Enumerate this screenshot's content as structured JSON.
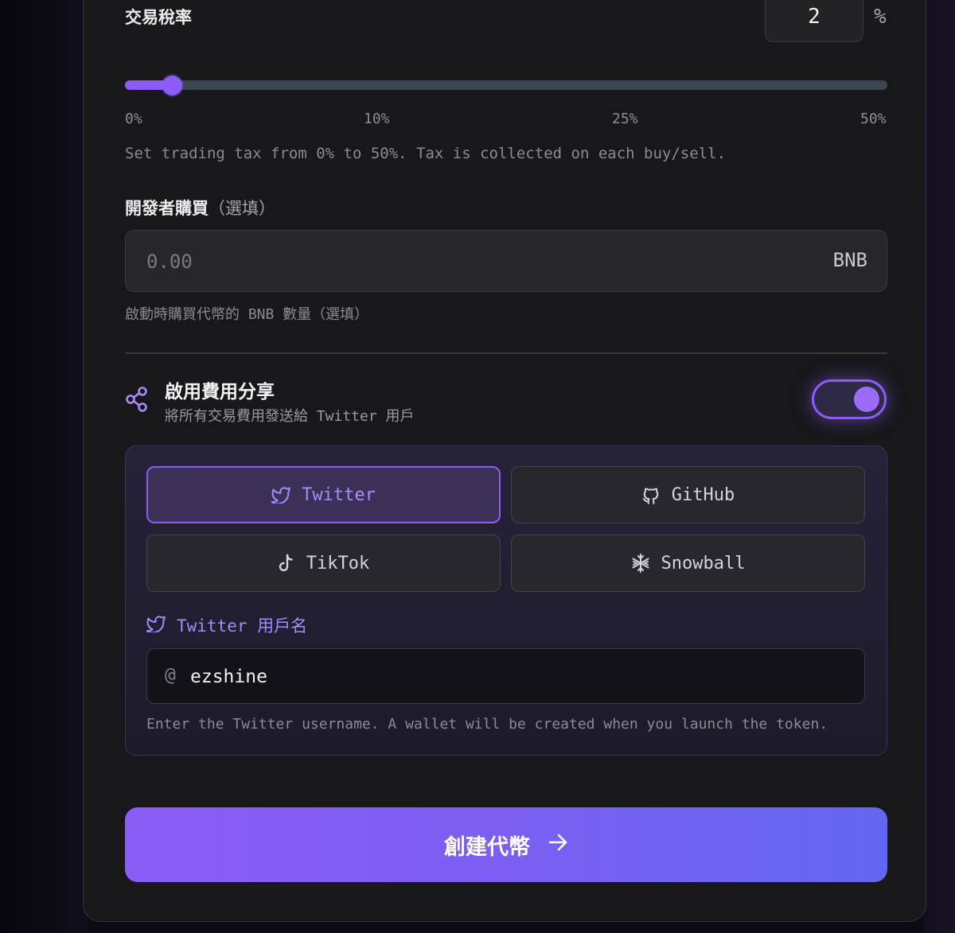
{
  "tax": {
    "label": "交易稅率",
    "value": "2",
    "unit": "%",
    "slider_value_percent": 2,
    "slider_max_percent": 50,
    "ticks": [
      "0%",
      "10%",
      "25%",
      "50%"
    ],
    "help": "Set trading tax from 0% to 50%. Tax is collected on each buy/sell."
  },
  "dev_buy": {
    "label": "開發者購買",
    "optional": "（選填）",
    "placeholder": "0.00",
    "unit": "BNB",
    "help": "啟動時購買代幣的 BNB 數量（選填）"
  },
  "fee_share": {
    "title": "啟用費用分享",
    "subtitle": "將所有交易費用發送給 Twitter 用戶",
    "enabled": true,
    "platforms": [
      {
        "label": "Twitter",
        "icon": "twitter-icon",
        "active": true
      },
      {
        "label": "GitHub",
        "icon": "github-icon",
        "active": false
      },
      {
        "label": "TikTok",
        "icon": "tiktok-icon",
        "active": false
      },
      {
        "label": "Snowball",
        "icon": "snowflake-icon",
        "active": false
      }
    ],
    "username_label": "Twitter 用戶名",
    "at_symbol": "@",
    "username_value": "ezshine",
    "username_help": "Enter the Twitter username. A wallet will be created when you launch the token."
  },
  "create_button": {
    "label": "創建代幣",
    "icon": "arrow-right-icon"
  },
  "colors": {
    "accent": "#8b5cf6",
    "accent_light": "#a78bfa",
    "gradient_end": "#6366f1",
    "card_bg": "#18181b"
  }
}
